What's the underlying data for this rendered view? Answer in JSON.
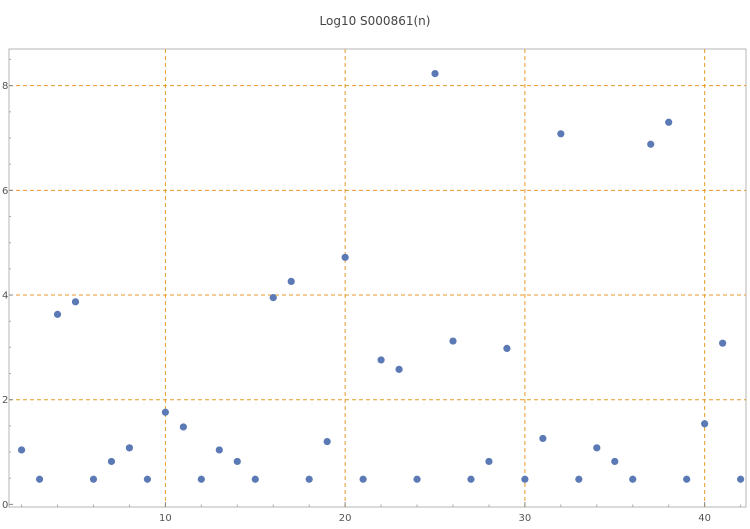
{
  "chart_data": {
    "type": "scatter",
    "title": "Log10 S000861(n)",
    "xlabel": "",
    "ylabel": "",
    "xlim": [
      1.3,
      42.3
    ],
    "ylim": [
      -0.05,
      8.7
    ],
    "xticks": [
      10,
      20,
      30,
      40
    ],
    "yticks": [
      0,
      2,
      4,
      6,
      8
    ],
    "grid": "dashed, at major ticks",
    "marker_color": "#5b7ab5",
    "grid_color": "#e69a28",
    "x": [
      2,
      3,
      4,
      5,
      6,
      7,
      8,
      9,
      10,
      11,
      12,
      13,
      14,
      15,
      16,
      17,
      18,
      19,
      20,
      21,
      22,
      23,
      24,
      25,
      26,
      27,
      28,
      29,
      30,
      31,
      32,
      33,
      34,
      35,
      36,
      37,
      38,
      39,
      40,
      41,
      42
    ],
    "y": [
      1.04,
      0.48,
      3.63,
      3.87,
      0.48,
      0.82,
      1.08,
      0.48,
      1.76,
      1.48,
      0.48,
      1.04,
      0.82,
      0.48,
      3.95,
      4.26,
      0.48,
      1.2,
      4.72,
      0.48,
      2.76,
      2.58,
      0.48,
      8.23,
      3.12,
      0.48,
      0.82,
      2.98,
      0.48,
      1.26,
      7.08,
      0.48,
      1.08,
      0.82,
      0.48,
      6.88,
      7.3,
      0.48,
      1.54,
      3.08,
      0.48
    ]
  }
}
